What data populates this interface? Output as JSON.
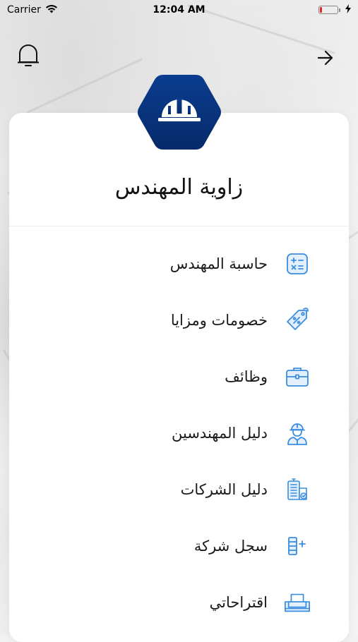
{
  "status_bar": {
    "carrier": "Carrier",
    "time": "12:04 AM",
    "battery_level": 0.12,
    "battery_color": "#e0292b"
  },
  "header": {
    "notification_icon": "bell-icon",
    "back_icon": "arrow-right-icon"
  },
  "app": {
    "title": "زاوية المهندس",
    "logo_icon": "hard-hat-icon",
    "brand_color": "#0b3d8f",
    "brand_color_dark": "#082c6b",
    "icon_color": "#3a8de0"
  },
  "menu": {
    "items": [
      {
        "label": "حاسبة المهندس",
        "icon": "calculator-icon"
      },
      {
        "label": "خصومات ومزايا",
        "icon": "discount-tag-icon"
      },
      {
        "label": "وظائف",
        "icon": "briefcase-icon"
      },
      {
        "label": "دليل المهندسين",
        "icon": "engineer-icon"
      },
      {
        "label": "دليل الشركات",
        "icon": "company-building-icon"
      },
      {
        "label": "سجل شركة",
        "icon": "register-company-icon"
      },
      {
        "label": "اقتراحاتي",
        "icon": "suggestion-box-icon"
      }
    ]
  }
}
